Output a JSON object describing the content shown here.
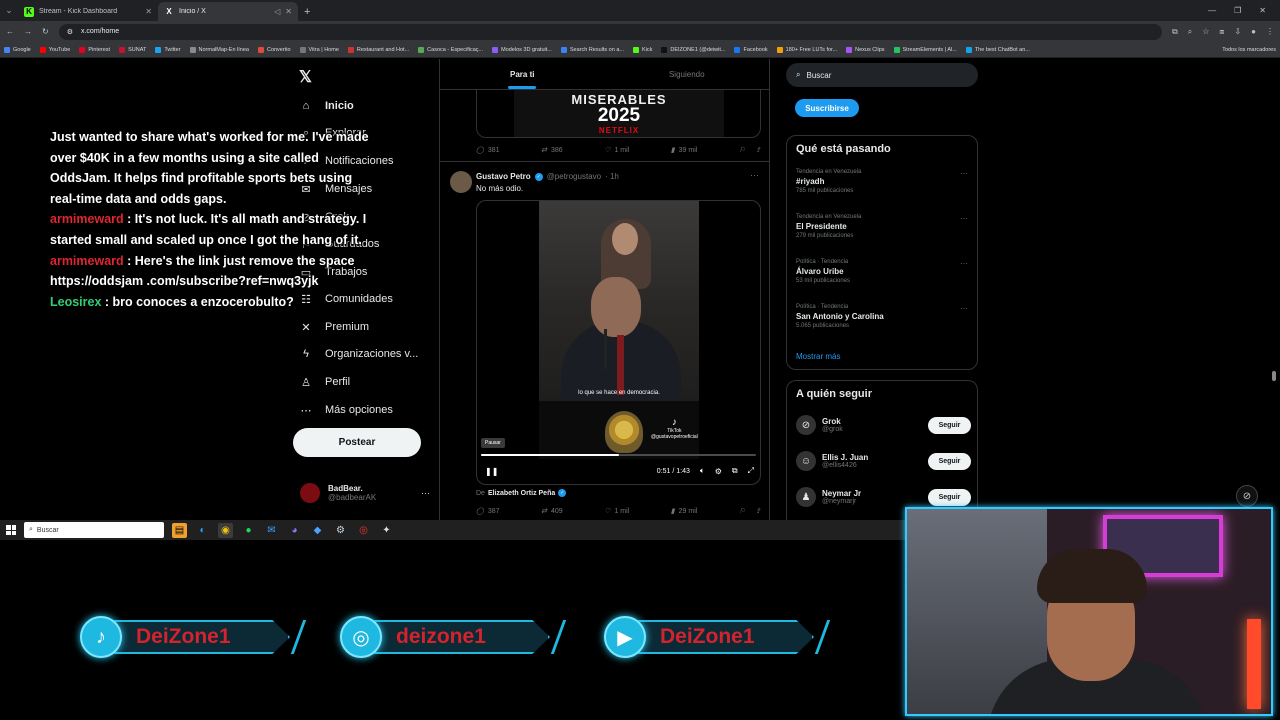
{
  "browser": {
    "tabs": [
      {
        "title": "Stream - Kick Dashboard",
        "favicon": "K",
        "active": false
      },
      {
        "title": "Inicio / X",
        "favicon": "X",
        "active": true
      }
    ],
    "url": "x.com/home",
    "bookmarks": [
      "Google",
      "YouTube",
      "Pinterest",
      "SUNAT",
      "Twitter",
      "NormalMap-En línea",
      "Convertio",
      "Vitra | Home",
      "Restaurant and Hot...",
      "Casoca - Especificaç...",
      "Modelos 3D gratuit...",
      "Search Results on a...",
      "Kick",
      "DEIZONE1 (@deiwit...",
      "Facebook",
      "180+ Free LUTs for...",
      "Nexus Clips",
      "StreamElements | Al...",
      "The best ChatBot an..."
    ],
    "all_bookmarks": "Todos los marcadores"
  },
  "x": {
    "nav": [
      {
        "label": "Inicio",
        "icon": "home-icon",
        "glyph": "⌂",
        "bold": true
      },
      {
        "label": "Explorar",
        "icon": "search-icon",
        "glyph": "⌕",
        "bold": false
      },
      {
        "label": "Notificaciones",
        "icon": "bell-icon",
        "glyph": "♪",
        "bold": false
      },
      {
        "label": "Mensajes",
        "icon": "mail-icon",
        "glyph": "✉",
        "bold": false
      },
      {
        "label": "Grok",
        "icon": "grok-icon",
        "glyph": "⊘",
        "bold": false
      },
      {
        "label": "Guardados",
        "icon": "bookmark-icon",
        "glyph": "⚐",
        "bold": false
      },
      {
        "label": "Trabajos",
        "icon": "briefcase-icon",
        "glyph": "▭",
        "bold": false
      },
      {
        "label": "Comunidades",
        "icon": "people-icon",
        "glyph": "☷",
        "bold": false
      },
      {
        "label": "Premium",
        "icon": "x-premium-icon",
        "glyph": "✕",
        "bold": false
      },
      {
        "label": "Organizaciones v...",
        "icon": "lightning-icon",
        "glyph": "ϟ",
        "bold": false
      },
      {
        "label": "Perfil",
        "icon": "person-icon",
        "glyph": "♙",
        "bold": false
      },
      {
        "label": "Más opciones",
        "icon": "more-circle-icon",
        "glyph": "⋯",
        "bold": false
      }
    ],
    "post_label": "Postear",
    "profile": {
      "name": "BadBear.",
      "handle": "@badbearAK"
    },
    "tabs": {
      "for_you": "Para ti",
      "following": "Siguiendo"
    },
    "top_post": {
      "poster_top": "MISERABLES",
      "poster_year": "2025",
      "poster_brand": "NETFLIX",
      "replies": "381",
      "reposts": "386",
      "likes": "1 mil",
      "views": "39 mil"
    },
    "tweet": {
      "name": "Gustavo Petro",
      "handle": "@petrogustavo",
      "time": "· 1h",
      "text": "No más odio.",
      "subtitle": "lo que se hace en democracia.",
      "tiktok": "TikTok",
      "tiktok_handle": "@gustavopetroeficial",
      "tooltip": "Pausar",
      "progress": 0.5,
      "time_display": "0:51 / 1:43",
      "from_prefix": "De",
      "from_name": "Elizabeth Ortiz Peña",
      "replies": "387",
      "reposts": "409",
      "likes": "1 mil",
      "views": "29 mil"
    },
    "search_placeholder": "Buscar",
    "subscribe_label": "Suscribirse",
    "trends_title": "Qué está pasando",
    "trends": [
      {
        "category": "Tendencia en Venezuela",
        "name": "#riyadh",
        "count": "785 mil publicaciones"
      },
      {
        "category": "Tendencia en Venezuela",
        "name": "El Presidente",
        "count": "279 mil publicaciones"
      },
      {
        "category": "Política · Tendencia",
        "name": "Álvaro Uribe",
        "count": "53 mil publicaciones"
      },
      {
        "category": "Política · Tendencia",
        "name": "San Antonio y Carolina",
        "count": "5.065 publicaciones"
      }
    ],
    "show_more": "Mostrar más",
    "follow_title": "A quién seguir",
    "follow": [
      {
        "name": "Grok",
        "handle": "@grok",
        "glyph": "⊘"
      },
      {
        "name": "Ellis J. Juan",
        "handle": "@ellis4426",
        "glyph": "☺"
      },
      {
        "name": "Neymar Jr",
        "handle": "@neymarjr",
        "glyph": "♟"
      }
    ],
    "follow_label": "Seguir"
  },
  "chat": [
    {
      "user": "",
      "color": "",
      "text": "Just wanted to share what's worked for me. I've made over $40K in a few months using a site called OddsJam. It helps find profitable sports bets using real-time data and odds gaps."
    },
    {
      "user": "armimeward",
      "color": "red",
      "text": ": It's not luck. It's all math and strategy. I started small and scaled up once I got the hang of it."
    },
    {
      "user": "armimeward",
      "color": "red",
      "text": ": Here's the link just remove the space https://oddsjam .com/subscribe?ref=nwq3yjk"
    },
    {
      "user": "Leosirex",
      "color": "green",
      "text": ": bro conoces a enzocerobulto?"
    }
  ],
  "taskbar": {
    "search": "Buscar"
  },
  "socials": [
    {
      "icon": "tiktok-icon",
      "glyph": "♪",
      "label": "DeiZone1"
    },
    {
      "icon": "instagram-icon",
      "glyph": "◎",
      "label": "deizone1"
    },
    {
      "icon": "youtube-icon",
      "glyph": "▶",
      "label": "DeiZone1"
    }
  ]
}
